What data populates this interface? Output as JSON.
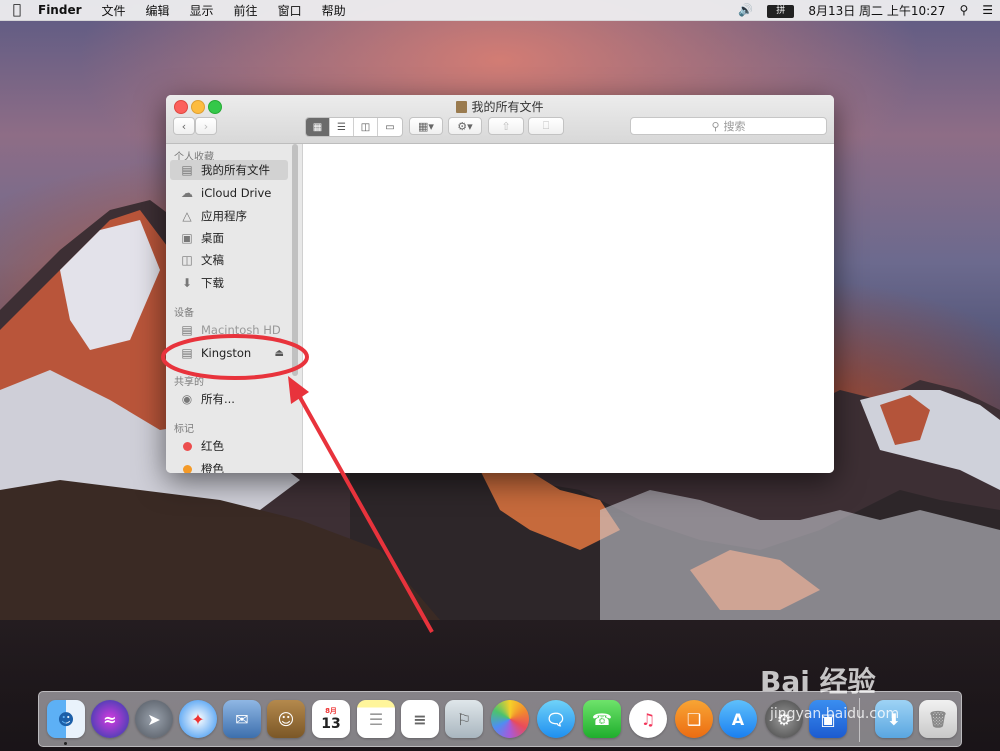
{
  "menubar": {
    "app": "Finder",
    "items": [
      "文件",
      "编辑",
      "显示",
      "前往",
      "窗口",
      "帮助"
    ],
    "ime": "拼",
    "datetime": "8月13日 周二 上午10:27"
  },
  "window": {
    "title": "我的所有文件",
    "search_placeholder": "搜索"
  },
  "sidebar": {
    "favorites_header": "个人收藏",
    "favorites": [
      {
        "label": "我的所有文件",
        "icon": "all-files-icon"
      },
      {
        "label": "iCloud Drive",
        "icon": "cloud-icon"
      },
      {
        "label": "应用程序",
        "icon": "applications-icon"
      },
      {
        "label": "桌面",
        "icon": "desktop-icon"
      },
      {
        "label": "文稿",
        "icon": "documents-icon"
      },
      {
        "label": "下载",
        "icon": "downloads-icon"
      }
    ],
    "devices_header": "设备",
    "devices": [
      {
        "label": "Macintosh HD",
        "icon": "hard-disk-icon"
      },
      {
        "label": "Kingston",
        "icon": "usb-drive-icon"
      }
    ],
    "shared_header": "共享的",
    "shared": [
      {
        "label": "所有...",
        "icon": "network-icon"
      }
    ],
    "tags_header": "标记",
    "tags": [
      {
        "label": "红色",
        "color": "#ec4d4d"
      },
      {
        "label": "橙色",
        "color": "#f49a28"
      }
    ]
  },
  "dock": {
    "calendar_month": "8月",
    "calendar_day": "13"
  },
  "watermark": {
    "logo": "Bai 经验",
    "url": "jingyan.baidu.com"
  },
  "colors": {
    "annotation": "#e8333c",
    "selection": "#d2d2d2"
  }
}
